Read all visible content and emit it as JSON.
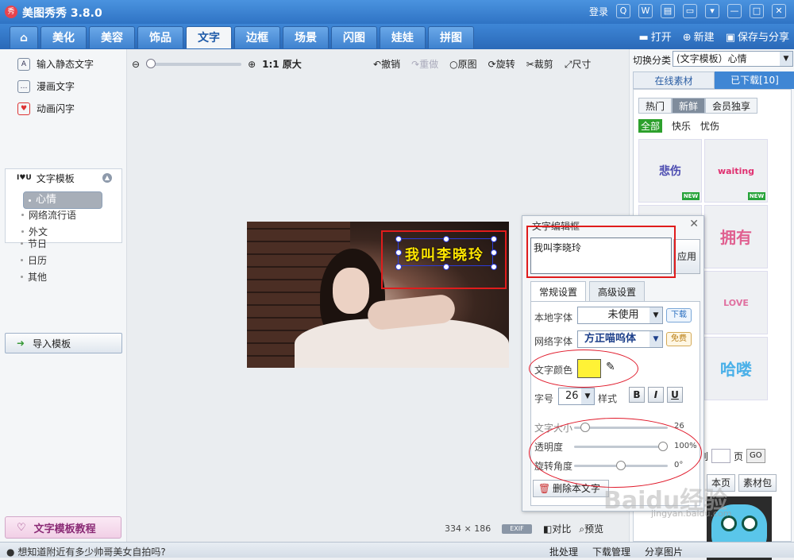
{
  "app": {
    "name": "美图秀秀 3.8.0",
    "logo_glyph": "秀",
    "login": "登录"
  },
  "nav": {
    "tabs": [
      "美化",
      "美容",
      "饰品",
      "文字",
      "边框",
      "场景",
      "闪图",
      "娃娃",
      "拼图"
    ],
    "active_tab": "文字",
    "open": "打开",
    "new": "新建",
    "save_share": "保存与分享"
  },
  "left": {
    "items": [
      "输入静态文字",
      "漫画文字",
      "动画闪字"
    ],
    "template_header": "文字模板",
    "categories": [
      "心情",
      "网络流行语",
      "外文",
      "节日",
      "日历",
      "其他"
    ],
    "selected_category": "心情",
    "import": "导入模板",
    "tutorial": "文字模板教程"
  },
  "toolbar": {
    "original_size": "1:1 原大",
    "undo": "撤销",
    "redo": "重做",
    "original": "原图",
    "rotate": "旋转",
    "crop": "裁剪",
    "size": "尺寸"
  },
  "canvas": {
    "overlay_text": "我叫李晓玲",
    "dimensions": "334 × 186",
    "exif": "EXIF",
    "compare": "对比",
    "preview": "预览"
  },
  "right": {
    "switch_label": "切换分类",
    "switch_value": "(文字模板）心情",
    "tab_online": "在线素材",
    "tab_downloaded": "已下载[10]",
    "filters": [
      "热门",
      "新鲜",
      "会员独享"
    ],
    "active_filter": "新鲜",
    "subfilters": [
      "全部",
      "快乐",
      "忧伤"
    ],
    "active_subfilter": "全部",
    "new_badge": "NEW",
    "page_to": "到",
    "page_unit": "页",
    "go": "GO",
    "this_page": "本页",
    "material_pack": "素材包"
  },
  "dialog": {
    "title": "文字编辑框",
    "text": "我叫李晓玲",
    "apply": "应用",
    "tab_general": "常规设置",
    "tab_advanced": "高级设置",
    "local_font_label": "本地字体",
    "local_font_value": "未使用",
    "download": "下载",
    "web_font_label": "网络字体",
    "web_font_value": "方正喵呜体",
    "free": "免费",
    "color_label": "文字颜色",
    "color_value": "#fff236",
    "size_label": "字号",
    "size_value": "26",
    "style_label": "样式",
    "bold": "B",
    "italic": "I",
    "underline": "U",
    "text_size_label": "文字大小",
    "text_size_value": "26",
    "text_size_fraction": 0.08,
    "opacity_label": "透明度",
    "opacity_value": "100%",
    "opacity_fraction": 1.0,
    "rotation_label": "旋转角度",
    "rotation_value": "0°",
    "rotation_fraction": 0.5,
    "delete": "删除本文字"
  },
  "footer": {
    "tip": "想知道附近有多少帅哥美女自拍吗?",
    "batch": "批处理",
    "download_mgr": "下载管理",
    "share": "分享图片"
  },
  "watermark": {
    "main": "Baidu经验",
    "sub": "jingyan.baidu.com"
  }
}
